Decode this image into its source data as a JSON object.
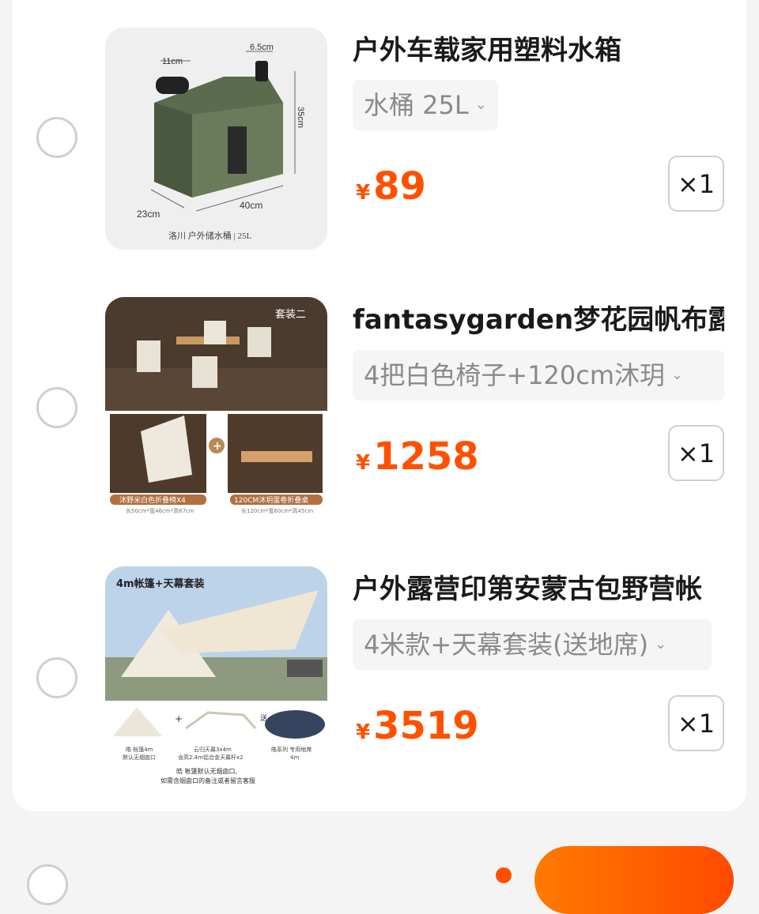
{
  "items": [
    {
      "title": "户外车载家用塑料水箱",
      "sku": "水桶 25L",
      "currency": "¥",
      "price": "89",
      "qty": "×1",
      "image": {
        "dim_width": "11cm",
        "dim_spout": "6.5cm",
        "dim_height": "35cm",
        "dim_depth": "23cm",
        "dim_length": "40cm",
        "caption": "洛川 户外储水桶 | 25L"
      }
    },
    {
      "title": "fantasygarden梦花园帆布露",
      "sku": "4把白色椅子+120cm沐玥",
      "currency": "¥",
      "price": "1258",
      "qty": "×1",
      "image": {
        "badge": "套装二",
        "chair_label": "沐野米白色折叠椅X4",
        "chair_size": "长50cm*宽46cm*高67cm",
        "table_label": "120CM沐玥蛋卷折叠桌",
        "table_size": "长120cm*宽60cm*高45cm"
      }
    },
    {
      "title": "户外露营印第安蒙古包野营帐",
      "sku": "4米款+天幕套装(送地席)",
      "currency": "¥",
      "price": "3519",
      "qty": "×1",
      "image": {
        "badge": "4m帐篷+天幕套装",
        "gift": "送",
        "part1": "皓 帐篷4m",
        "part1_sub": "默认无烟囱口",
        "part2": "云归天幕3x4m",
        "part2_sub": "含高2.4m铝合金天幕杆x2",
        "part3": "皓系列 专用地席",
        "part3_sub": "4m",
        "note1": "皓 帐篷默认无烟囱口,",
        "note2": "如需含烟囱口的备注或者留言客服"
      }
    }
  ],
  "colors": {
    "accent": "#ff5000",
    "sku_bg": "#f5f5f5",
    "border": "#cfcfcf"
  }
}
